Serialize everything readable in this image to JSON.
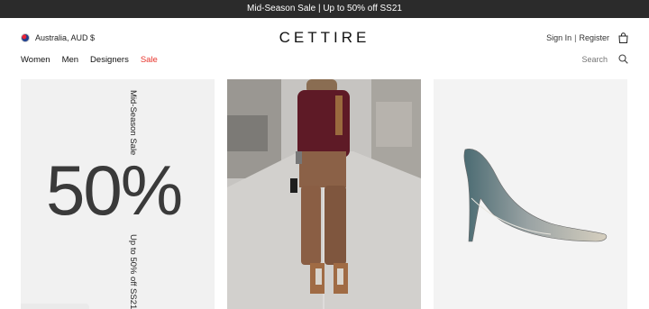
{
  "promo": {
    "text": "Mid-Season Sale | Up to 50% off SS21"
  },
  "header": {
    "locale": "Australia, AUD $",
    "logo": "CETTIRE",
    "sign_in": "Sign In",
    "separator": "|",
    "register": "Register"
  },
  "nav": {
    "items": [
      "Women",
      "Men",
      "Designers",
      "Sale"
    ],
    "sale_color": "#e8342b"
  },
  "search": {
    "placeholder": "Search"
  },
  "tiles": {
    "sale": {
      "top_text": "Mid-Season Sale",
      "big_text": "50%",
      "bottom_text": "Up to 50% off SS21"
    }
  },
  "icons": [
    "australia-flag-icon",
    "shopping-bag-icon",
    "search-icon"
  ],
  "colors": {
    "promo_bg": "#2b2b2b",
    "accent_sale": "#e8342b"
  }
}
